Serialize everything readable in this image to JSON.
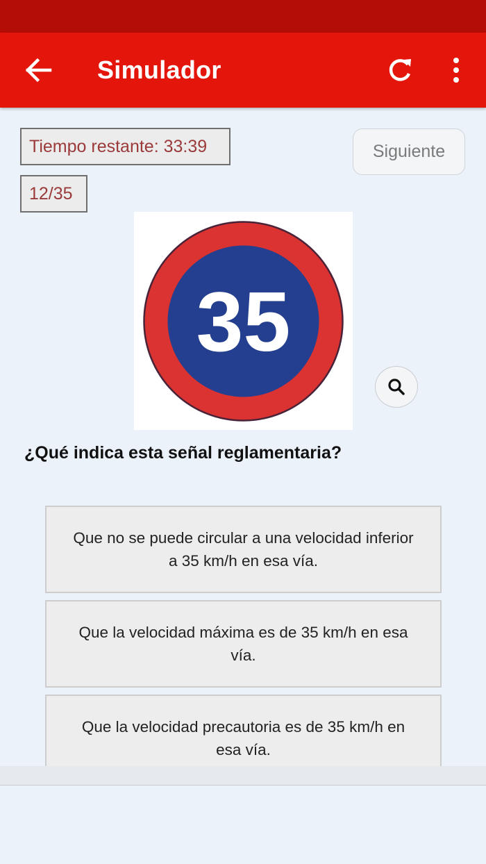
{
  "app_bar": {
    "title": "Simulador",
    "back_icon": "arrow-left-icon",
    "refresh_icon": "refresh-icon",
    "menu_icon": "more-vertical-icon",
    "color": "#e4150b",
    "status_color": "#b30d05"
  },
  "quiz": {
    "timer": "Tiempo restante: 33:39",
    "counter": "12/35",
    "next_label": "Siguiente",
    "sign_number": "35",
    "zoom_icon": "search-icon",
    "question": "¿Qué indica esta señal reglamentaria?",
    "answers": [
      "Que no se puede circular a una velocidad inferior a 35 km/h en esa vía.",
      "Que la velocidad máxima es de 35 km/h en esa vía.",
      "Que la velocidad precautoria es de 35 km/h en esa vía."
    ]
  }
}
